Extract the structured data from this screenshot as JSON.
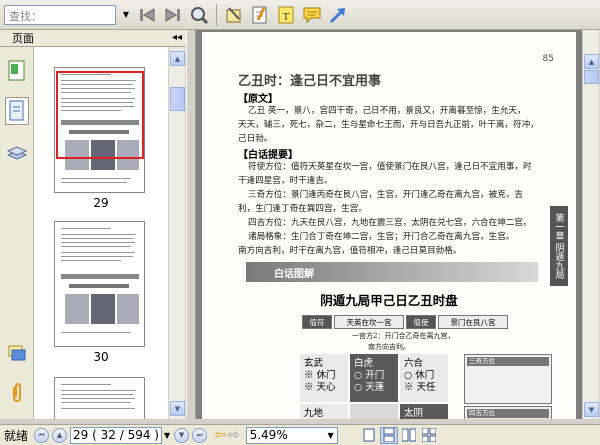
{
  "toolbar": {
    "search_placeholder": "查找：",
    "icons": [
      "back-icon",
      "forward-icon",
      "zoom-icon",
      "hand-tool-icon",
      "note-icon",
      "text-icon",
      "comment-icon",
      "arrow-icon"
    ]
  },
  "left_panel": {
    "header": "页面",
    "collapse_glyph": "◂◂",
    "thumbnails": [
      {
        "page": "29"
      },
      {
        "page": "30"
      }
    ]
  },
  "document": {
    "page_title": "乙丑时：逢己日不宜用事",
    "top_page_number": "85",
    "sections": {
      "original_heading": "【原文】",
      "original_text_1": "乙丑 英一，景八，宫四干奇，己日不用，景良又，开离暮至惊，生允天，",
      "original_text_2": "天天，辅三，死七，杂二，生与星命七王而，开与日吾九正前，叶干离，符冲，",
      "original_text_3": "己日勃。",
      "summary_heading": "【白话提要】",
      "summary_1": "符使方位：值符天英星在坎一宫，值使景门在艮八宫，逢己日不宜用事，时",
      "summary_2": "干逢四星宫，时干逢吉。",
      "summary_3": "三奇方位：景门逢丙奇在艮八宫，生宫，开门逢乙奇在离九宫，被克，吉",
      "summary_4": "利，生门逢丁奇在巽四宫，生宫。",
      "summary_5": "四吉方位：九天在艮八宫，九地在震三宫，太阴在兑七宫，六合在坤二宫。",
      "summary_6": "诸局格象：生门合丁奇在坤二宫，生宫；开门合乙奇在离九宫，生宫。",
      "summary_7": "南方向吉利，时干在离九宫，值符相冲，逢己日莫目勃格。"
    },
    "banner_label": "白话图解",
    "diagram_title": "阴遁九局甲己日乙丑时盘",
    "tags": [
      "值符",
      "天英在坎一宫",
      "值使",
      "景门在艮八宫"
    ],
    "grid": [
      {
        "line1": "玄武",
        "line2": "※ 休门",
        "line3": "※ 天心"
      },
      {
        "line1": "白虎",
        "line2": "○ 开门",
        "line3": "○ 天蓬"
      },
      {
        "line1": "六合",
        "line2": "○ 休门",
        "line3": "※ 天任"
      },
      {
        "line1": "九地",
        "line2": "",
        "line3": ""
      },
      {
        "line1": "",
        "line2": "",
        "line3": ""
      },
      {
        "line1": "太阴",
        "line2": "",
        "line3": ""
      }
    ],
    "annotation": "一宫方2：开门合乙奇在离九宫，",
    "annotation_2": "南方向吉利。",
    "side_box_1_title": "三奇方位",
    "side_box_2_title": "四吉方位",
    "chapter_label": "第一章 阴遁九局"
  },
  "statusbar": {
    "status": "就绪",
    "current_page": "29",
    "page_of_total": "( 32 / 594 )",
    "zoom": "5.49%"
  }
}
